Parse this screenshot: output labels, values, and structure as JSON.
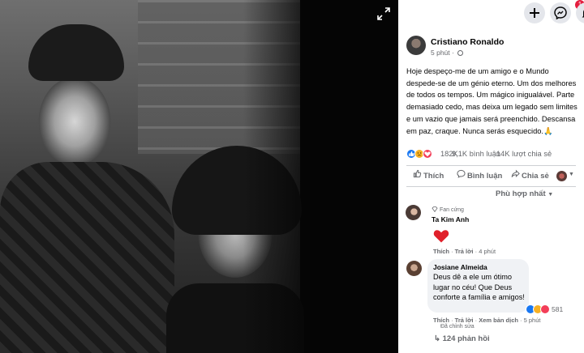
{
  "photo_alt": "",
  "topbar": {
    "notification_badge": "1"
  },
  "post": {
    "author": "Cristiano Ronaldo",
    "time": "5 phút",
    "text": "Hoje despeço-me de um amigo e o Mundo despede-se de um génio eterno. Um dos melhores de todos os tempos. Um mágico inigualável. Parte demasiado cedo, mas deixa um legado sem limites e um vazio que jamais será preenchido. Descansa em paz, craque. Nunca serás esquecido.🙏",
    "reaction_count": "182K",
    "comment_count": "9,1K bình luận",
    "share_count": "14K lượt chia sẻ"
  },
  "actions": {
    "like": "Thích",
    "comment": "Bình luận",
    "share": "Chia sẻ"
  },
  "sort_label": "Phù hợp nhất",
  "comments": [
    {
      "badge": "Fan cứng",
      "name": "Ta Kim Anh",
      "content_emoji": "heart",
      "like": "Thích",
      "reply": "Trả lời",
      "time": "4 phút"
    },
    {
      "name": "Josiane Almeida",
      "text": "Deus dê a ele um ótimo lugar no céu! Que Deus conforte a família e amigos!",
      "reaction_count": "581",
      "like": "Thích",
      "reply": "Trả lời",
      "translate": "Xem bản dịch",
      "time": "5 phút",
      "edited": "Đã chỉnh sửa"
    }
  ],
  "view_replies": "124 phản hồi",
  "colors": {
    "like_blue": "#1877f2",
    "love_red": "#f33e58",
    "haha_yellow": "#f7b125",
    "muted_text": "#65676b"
  }
}
